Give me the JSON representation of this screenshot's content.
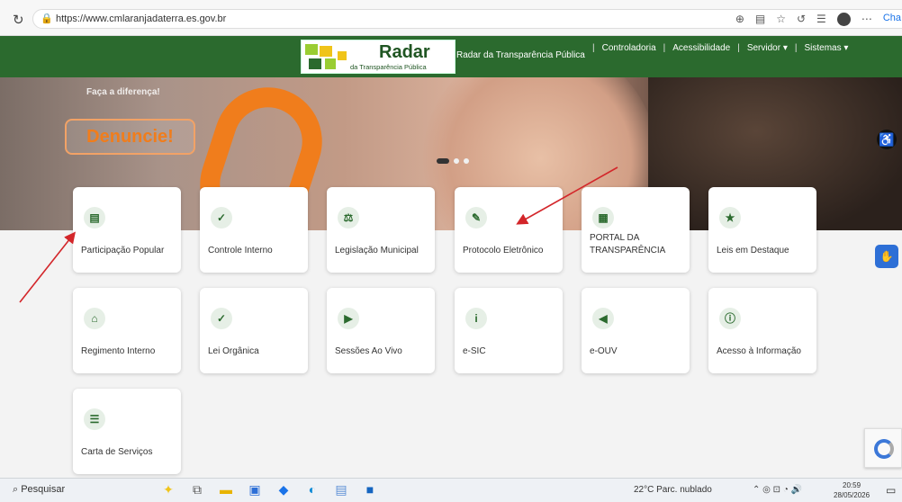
{
  "browser": {
    "url": "https://www.cmlaranjadaterra.es.gov.br",
    "profile_label": "Cha"
  },
  "header": {
    "logo_title": "Radar",
    "logo_subtitle": "da Transparência Pública",
    "tagline": "Radar da Transparência Pública",
    "nav": [
      {
        "label": "Controladoria"
      },
      {
        "label": "Acessibilidade"
      },
      {
        "label": "Servidor ▾"
      },
      {
        "label": "Sistemas ▾"
      }
    ]
  },
  "hero": {
    "top_line": "Faça a diferença!",
    "cta": "Denuncie!"
  },
  "cards": [
    {
      "label": "Participação Popular",
      "icon": "document-icon"
    },
    {
      "label": "Controle Interno",
      "icon": "document-check-icon"
    },
    {
      "label": "Legislação Municipal",
      "icon": "law-book-icon"
    },
    {
      "label": "Protocolo Eletrônico",
      "icon": "document-edit-icon"
    },
    {
      "label": "PORTAL DA TRANSPARÊNCIA",
      "icon": "portal-icon"
    },
    {
      "label": "Leis em Destaque",
      "icon": "document-star-icon"
    },
    {
      "label": "Regimento Interno",
      "icon": "building-icon"
    },
    {
      "label": "Lei Orgânica",
      "icon": "document-check-icon"
    },
    {
      "label": "Sessões Ao Vivo",
      "icon": "video-icon"
    },
    {
      "label": "e-SIC",
      "icon": "info-icon"
    },
    {
      "label": "e-OUV",
      "icon": "megaphone-icon"
    },
    {
      "label": "Acesso à Informação",
      "icon": "info-document-icon"
    },
    {
      "label": "Carta de Serviços",
      "icon": "service-icon"
    }
  ],
  "taskbar": {
    "search_placeholder": "Pesquisar",
    "weather": "22°C  Parc. nublado",
    "time": "20:59",
    "date": "28/05/2026"
  },
  "colors": {
    "brand_green": "#2b6a2e",
    "accent_orange": "#f07d1c",
    "arrow_red": "#d3262a"
  }
}
